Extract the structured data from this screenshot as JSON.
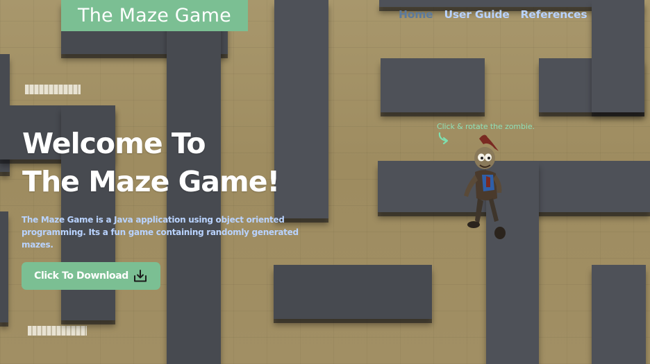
{
  "brand": {
    "title": "The Maze Game"
  },
  "nav": {
    "items": [
      {
        "label": "Home",
        "active": true
      },
      {
        "label": "User Guide",
        "active": false
      },
      {
        "label": "References",
        "active": false
      }
    ]
  },
  "hero": {
    "title_line1": "Welcome To",
    "title_line2": "The Maze Game!",
    "description": "The Maze Game is a Java application using object oriented programming. Its a fun game containing randomly generated mazes.",
    "download_label": "Click To Download",
    "download_icon": "download-icon"
  },
  "zombie": {
    "hint": "Click & rotate the zombie.",
    "hint_icon": "curved-arrow-icon"
  },
  "colors": {
    "accent": "#7bbf93",
    "nav_link": "#b9d3ff",
    "nav_active": "#5c7a9c",
    "hint": "#8fe0b8",
    "wall": "#474a50",
    "floor": "#a08e63"
  }
}
